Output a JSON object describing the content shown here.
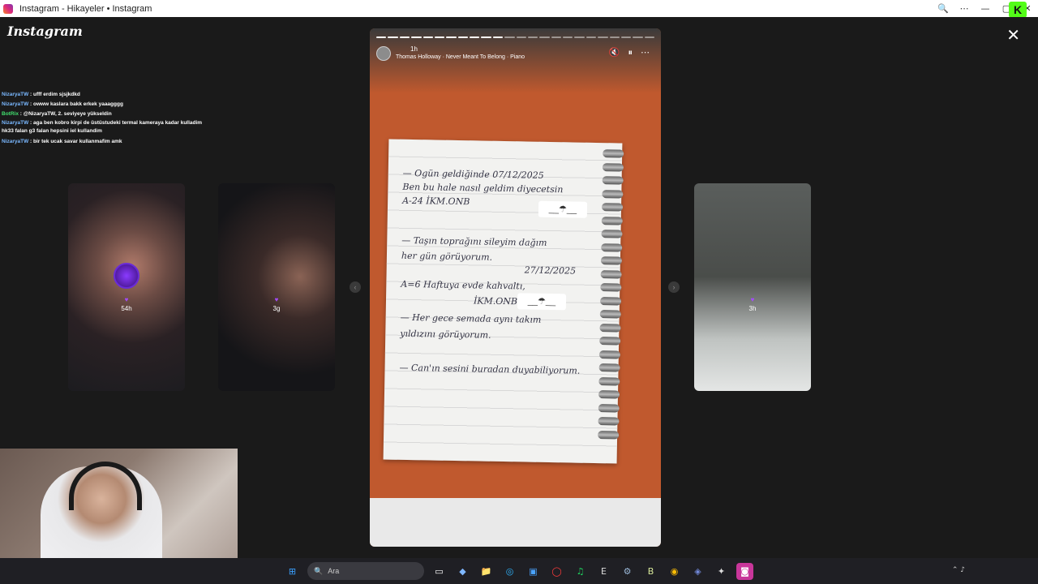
{
  "window": {
    "title": "Instagram - Hikayeler • Instagram",
    "controls": [
      "🔍",
      "⋯",
      "—",
      "▢",
      "✕"
    ],
    "kick_badge": "K"
  },
  "instagram": {
    "logo": "Instagram",
    "close": "✕"
  },
  "chat": {
    "messages": [
      {
        "user": "NizaryaTW",
        "text": " : ufff erdim sjsjkdkd",
        "type": "user"
      },
      {
        "user": "NizaryaTW",
        "text": " : owww kaslara bakk erkek yaaagggg",
        "type": "user"
      },
      {
        "user": "BotRix",
        "text": " : @NizaryaTW, 2. seviyeye yükseldin",
        "type": "bot"
      },
      {
        "user": "NizaryaTW",
        "text": " : aga ben kobro kirpi de üstüstudeki termal kameraya kadar kulladim hk33 falan g3 falan hepsini iel kullandim",
        "type": "user"
      },
      {
        "user": "NizaryaTW",
        "text": " : bir tek ucak savar kullanmafim amk",
        "type": "user"
      }
    ]
  },
  "previews": {
    "left1": {
      "age": "54h"
    },
    "left2": {
      "age": "3g"
    },
    "right1": {
      "age": "3h"
    }
  },
  "nav": {
    "prev": "‹",
    "next": "›"
  },
  "story": {
    "time": "1h",
    "music": "Thomas Holloway · Never Meant To Belong · Piano",
    "progress_segments": 24,
    "progress_done": 11,
    "icons": {
      "mute": "🔇",
      "pause": "⏸",
      "more": "⋯"
    },
    "note_lines": [
      "— Ogün geldiğinde   07/12/2025",
      "Ben bu hale nasıl geldim diyecetsin",
      "A-24          İKM.ONB",
      "— Taşın toprağını sileyim dağım",
      "her gün görüyorum.",
      "27/12/2025",
      "A=6 Haftuya evde kahvaltı,",
      "İKM.ONB",
      "— Her gece semada aynı takım",
      "yıldızını görüyorum.",
      "— Can'ın sesini buradan duyabiliyorum."
    ],
    "sticker": "__☂__"
  },
  "taskbar": {
    "search_label": "Ara",
    "icons": [
      "⊞",
      "▭",
      "◆",
      "📁",
      "◎",
      "▣",
      "◯",
      "♫",
      "E",
      "⚙",
      "B",
      "◉",
      "◈",
      "✦",
      "◙"
    ],
    "tray": "⌃  ♪"
  }
}
